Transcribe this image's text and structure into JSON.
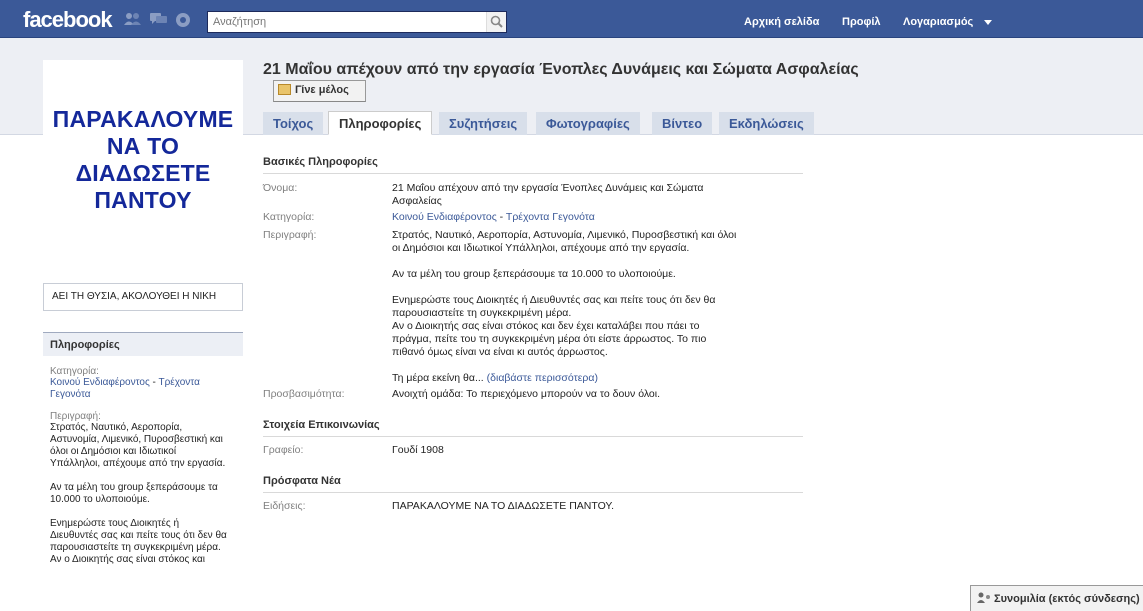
{
  "topbar": {
    "logo": "facebook",
    "search_placeholder": "Αναζήτηση",
    "nav": {
      "home": "Αρχική σελίδα",
      "profile": "Προφίλ",
      "account": "Λογαριασμός"
    }
  },
  "profile_picture": {
    "line1": "ΠΑΡΑΚΑΛΟΥΜΕ",
    "line2": "ΝΑ ΤΟ",
    "line3": "ΔΙΑΔΩΣΕΤΕ",
    "line4": "ΠΑΝΤΟΥ"
  },
  "motto": "ΑΕΙ ΤΗ ΘΥΣΙΑ, ΑΚΟΛΟΥΘΕΙ Η ΝΙΚΗ",
  "sidebar": {
    "heading": "Πληροφορίες",
    "category_label": "Κατηγορία:",
    "category_link1": "Κοινού Ενδιαφέροντος",
    "category_sep": " - ",
    "category_link2": "Τρέχοντα Γεγονότα",
    "description_label": "Περιγραφή:",
    "desc_p1": "Στρατός, Ναυτικό, Αεροπορία, Αστυνομία, Λιμενικό, Πυροσβεστική και όλοι οι Δημόσιοι και Ιδιωτικοί Υπάλληλοι, απέχουμε από την εργασία.",
    "desc_p2": "Αν τα μέλη του group ξεπεράσουμε τα 10.000 το υλοποιούμε.",
    "desc_p3": "Ενημερώστε τους Διοικητές ή Διευθυντές σας και πείτε τους ότι δεν θα παρουσιαστείτε τη συγκεκριμένη μέρα.",
    "desc_p4": "Αν ο Διοικητής σας είναι στόκος και"
  },
  "group": {
    "title": "21 Μαΐου απέχουν από την εργασία Ένοπλες Δυνάμεις και Σώματα Ασφαλείας",
    "join_label": "Γίνε μέλος"
  },
  "tabs": [
    "Τοίχος",
    "Πληροφορίες",
    "Συζητήσεις",
    "Φωτογραφίες",
    "Βίντεο",
    "Εκδηλώσεις"
  ],
  "basic_info": {
    "heading": "Βασικές Πληροφορίες",
    "name_label": "Όνομα:",
    "name_value": "21 Μαΐου απέχουν από την εργασία Ένοπλες Δυνάμεις και Σώματα Ασφαλείας",
    "category_label": "Κατηγορία:",
    "category_link1": "Κοινού Ενδιαφέροντος",
    "category_sep": " - ",
    "category_link2": "Τρέχοντα Γεγονότα",
    "description_label": "Περιγραφή:",
    "desc_p1": "Στρατός, Ναυτικό, Αεροπορία, Αστυνομία, Λιμενικό, Πυροσβεστική και όλοι οι Δημόσιοι και Ιδιωτικοί Υπάλληλοι, απέχουμε από την εργασία.",
    "desc_p2": "Αν τα μέλη του group ξεπεράσουμε τα 10.000 το υλοποιούμε.",
    "desc_p3": "Ενημερώστε τους Διοικητές ή Διευθυντές σας και πείτε τους ότι δεν θα παρουσιαστείτε τη συγκεκριμένη μέρα.",
    "desc_p4": "Αν ο Διοικητής σας είναι στόκος και δεν έχει καταλάβει που πάει το πράγμα, πείτε του τη συγκεκριμένη μέρα ότι είστε άρρωστος. Το πιο πιθανό όμως είναι να είναι κι αυτός άρρωστος.",
    "desc_p5": "Τη μέρα εκείνη θα...",
    "read_more": "(διαβάστε περισσότερα)",
    "access_label": "Προσβασιμότητα:",
    "access_value": "Ανοιχτή ομάδα: Το περιεχόμενο μπορούν να το δουν όλοι."
  },
  "contact": {
    "heading": "Στοιχεία Επικοινωνίας",
    "office_label": "Γραφείο:",
    "office_value": "Γουδί 1908"
  },
  "news": {
    "heading": "Πρόσφατα Νέα",
    "label": "Ειδήσεις:",
    "value": "ΠΑΡΑΚΑΛΟΥΜΕ ΝΑ ΤΟ ΔΙΑΔΩΣΕΤΕ ΠΑΝΤΟΥ."
  },
  "chat": {
    "label": "Συνομιλία (εκτός σύνδεσης)"
  },
  "colors": {
    "topbar": "#3b5998",
    "link": "#3b5998",
    "tab_bg": "#d8dfea",
    "band": "#edeff4",
    "picture_text": "#14289a"
  },
  "icons": [
    "friend-requests-icon",
    "messages-icon",
    "notifications-icon",
    "search-icon",
    "dropdown-arrow-icon",
    "join-icon",
    "chat-icon"
  ]
}
